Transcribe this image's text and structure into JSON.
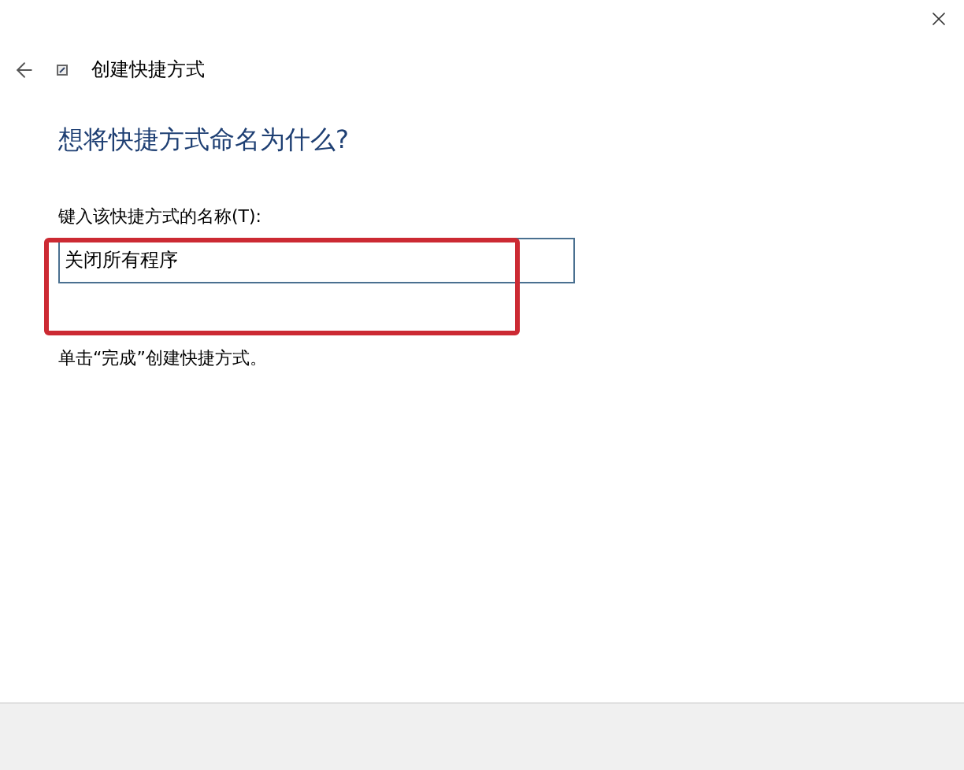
{
  "window": {
    "title": "创建快捷方式"
  },
  "heading": "想将快捷方式命名为什么?",
  "name_field": {
    "label": "键入该快捷方式的名称(T):",
    "value": "关闭所有程序"
  },
  "hint": "单击“完成”创建快捷方式。"
}
